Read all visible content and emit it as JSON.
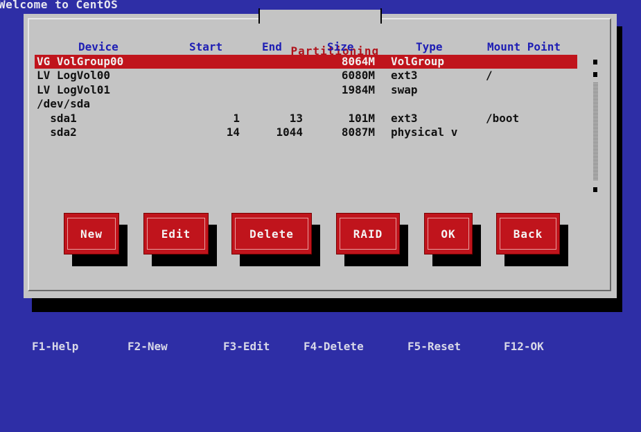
{
  "app": {
    "welcome": "Welcome to CentOS"
  },
  "dialog": {
    "title": "Partitioning"
  },
  "table": {
    "headers": {
      "device": "Device",
      "start": "Start",
      "end": "End",
      "size": "Size",
      "type": "Type",
      "mount": "Mount Point"
    },
    "rows": [
      {
        "device": "VG VolGroup00",
        "start": "",
        "end": "",
        "size": "8064M",
        "type": "VolGroup",
        "mount": "",
        "selected": true
      },
      {
        "device": "LV LogVol00",
        "start": "",
        "end": "",
        "size": "6080M",
        "type": "ext3",
        "mount": "/"
      },
      {
        "device": "LV LogVol01",
        "start": "",
        "end": "",
        "size": "1984M",
        "type": "swap",
        "mount": ""
      },
      {
        "device": "/dev/sda",
        "start": "",
        "end": "",
        "size": "",
        "type": "",
        "mount": ""
      },
      {
        "device": "  sda1",
        "start": "1",
        "end": "13",
        "size": "101M",
        "type": "ext3",
        "mount": "/boot"
      },
      {
        "device": "  sda2",
        "start": "14",
        "end": "1044",
        "size": "8087M",
        "type": "physical v",
        "mount": ""
      }
    ]
  },
  "buttons": {
    "new": "New",
    "edit": "Edit",
    "delete": "Delete",
    "raid": "RAID",
    "ok": "OK",
    "back": "Back"
  },
  "footer": {
    "f1": "F1-Help",
    "f2": "F2-New",
    "f3": "F3-Edit",
    "f4": "F4-Delete",
    "f5": "F5-Reset",
    "f12": "F12-OK"
  },
  "colors": {
    "background": "#2e2ea6",
    "dialog": "#c4c4c4",
    "accent_red": "#c0141c",
    "header_blue": "#1e1eb4"
  }
}
